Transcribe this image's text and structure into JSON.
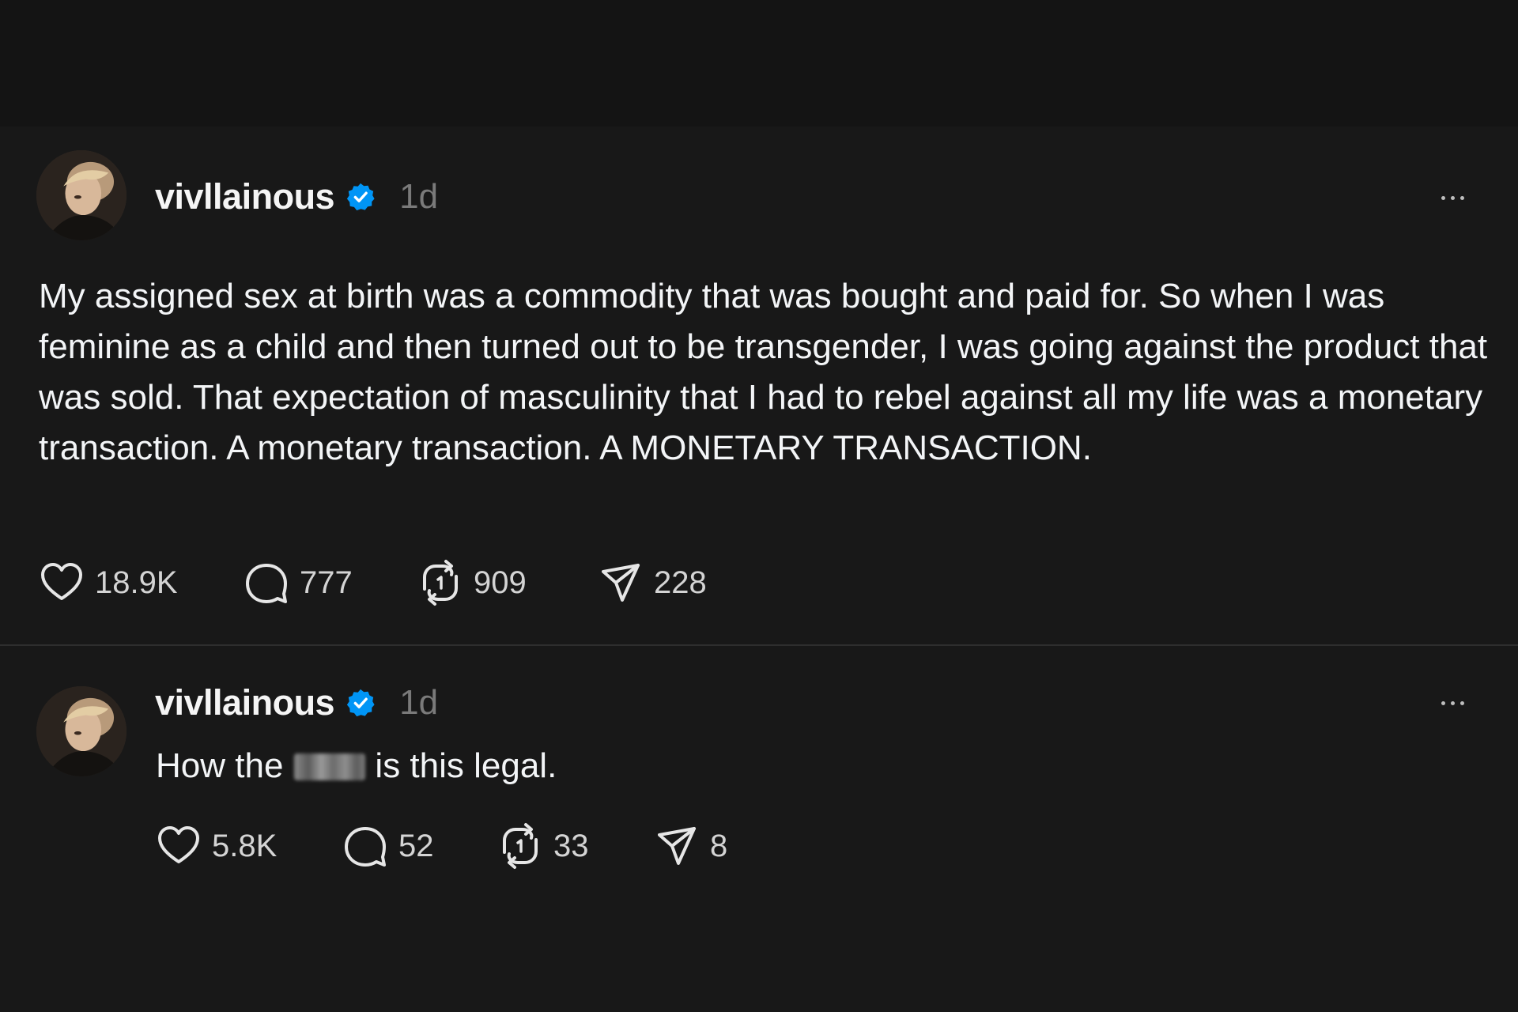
{
  "posts": [
    {
      "username": "vivllainous",
      "verified": true,
      "timestamp": "1d",
      "text": "My assigned sex at birth was a commodity that was bought and paid for. So when I was feminine as a child and then turned out to be transgender, I was going against the product that was sold. That expectation of masculinity that I had to rebel against all my life was a monetary transaction. A monetary transaction. A MONETARY TRANSACTION.",
      "likes": "18.9K",
      "replies": "777",
      "reposts": "909",
      "shares": "228"
    },
    {
      "username": "vivllainous",
      "verified": true,
      "timestamp": "1d",
      "text_before": "How the",
      "text_after": "is this legal.",
      "likes": "5.8K",
      "replies": "52",
      "reposts": "33",
      "shares": "8"
    }
  ],
  "colors": {
    "background": "#181818",
    "text": "#f3f5f7",
    "muted": "#7a7a7a",
    "verified_badge": "#0095f6",
    "divider": "#2e2e2e"
  },
  "icons": [
    "heart-icon",
    "comment-icon",
    "repost-icon",
    "share-icon",
    "more-icon",
    "verified-badge-icon"
  ]
}
